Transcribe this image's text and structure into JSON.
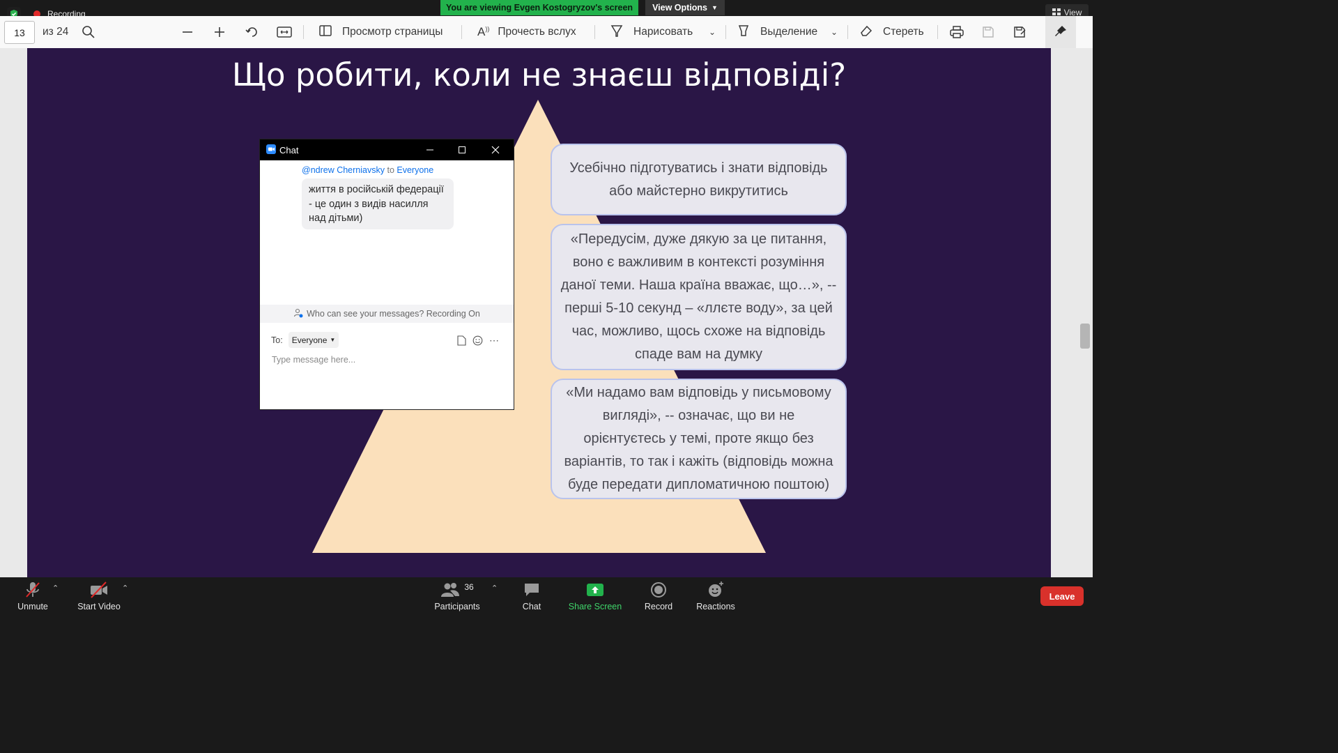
{
  "top_strip": {
    "recording_label": "Recording",
    "viewing_banner": "You are viewing Evgen Kostogryzov's screen",
    "view_options": "View Options",
    "view_right": "View"
  },
  "pdf_toolbar": {
    "page_current": "13",
    "page_total": "из 24",
    "page_view": "Просмотр страницы",
    "read_aloud": "Прочесть вслух",
    "draw": "Нарисовать",
    "highlight": "Выделение",
    "erase": "Стереть"
  },
  "slide": {
    "title": "Що робити, коли не знаєш відповіді?",
    "box1": "Усебічно підготуватись і знати відповідь або майстерно викрутитись",
    "box2": "«Передусім, дуже дякую за це питання, воно є важливим в контексті розуміння даної теми. Наша країна вважає, що…», -- перші 5-10 секунд – «ллєте воду», за цей час, можливо, щось схоже на відповідь спаде вам на думку",
    "box3": "«Ми надамо вам відповідь у письмовому вигляді», -- означає, що ви не орієнтуєтесь у темі, проте якщо без варіантів, то так і кажіть (відповідь можна буде передати дипломатичною поштою)",
    "colors": {
      "background": "#2a1646",
      "pyramid": "#fbe0bb"
    }
  },
  "chat": {
    "title": "Chat",
    "sender": "@ndrew Cherniavsky",
    "to_word": "to",
    "recipient": "Everyone",
    "message": "життя в російській федерації -  це один з видів насилля над дітьми)",
    "privacy_note": "Who can see your messages? Recording On",
    "to_label": "To:",
    "to_value": "Everyone",
    "input_placeholder": "Type message here..."
  },
  "bottom_bar": {
    "unmute": "Unmute",
    "start_video": "Start Video",
    "participants": "Participants",
    "participants_count": "36",
    "chat": "Chat",
    "share_screen": "Share Screen",
    "record": "Record",
    "reactions": "Reactions",
    "leave": "Leave",
    "colors": {
      "share": "#22b24c",
      "leave": "#d9312b"
    }
  }
}
